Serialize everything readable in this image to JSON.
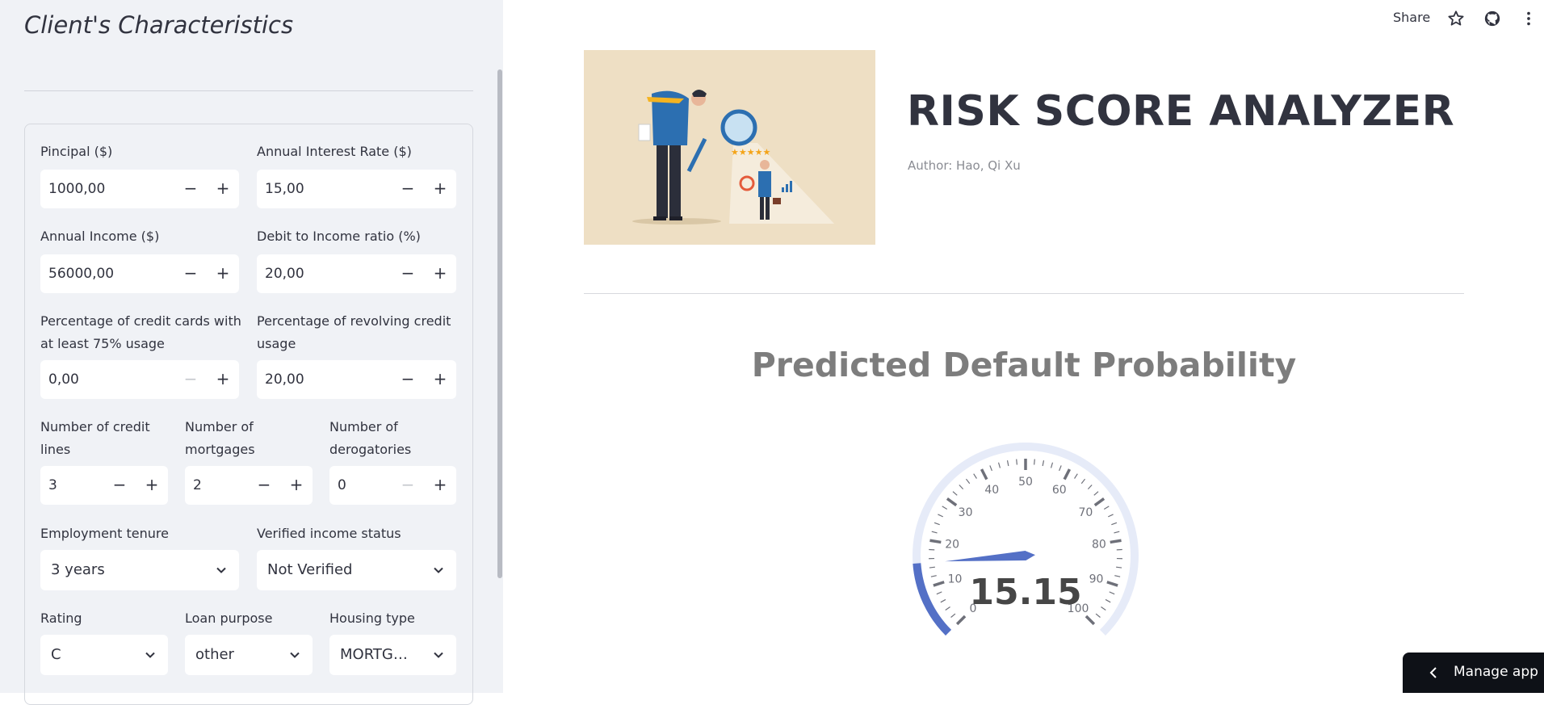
{
  "sidebar": {
    "title": "Client's Characteristics",
    "fields": {
      "principal": {
        "label": "Pincipal ($)",
        "value": "1000,00"
      },
      "interest": {
        "label": "Annual Interest Rate ($)",
        "value": "15,00"
      },
      "income": {
        "label": "Annual Income ($)",
        "value": "56000,00"
      },
      "dti": {
        "label": "Debit to Income ratio (%)",
        "value": "20,00"
      },
      "cc75_line1": "Percentage of credit cards with",
      "cc75_line2": "at least 75% usage",
      "cc75_value": "0,00",
      "revolving_line1": "Percentage of revolving credit",
      "revolving_line2": "usage",
      "revolving_value": "20,00",
      "credit_lines_line1": "Number of credit",
      "credit_lines_line2": "lines",
      "credit_lines_value": "3",
      "mortgages_line1": "Number of",
      "mortgages_line2": "mortgages",
      "mortgages_value": "2",
      "derog_line1": "Number of",
      "derog_line2": "derogatories",
      "derog_value": "0",
      "tenure": {
        "label": "Employment tenure",
        "value": "3 years"
      },
      "verified": {
        "label": "Verified income status",
        "value": "Not Verified"
      },
      "rating": {
        "label": "Rating",
        "value": "C"
      },
      "purpose": {
        "label": "Loan purpose",
        "value": "other"
      },
      "housing": {
        "label": "Housing type",
        "value": "MORTG…"
      }
    },
    "minus_symbol": "−",
    "plus_symbol": "+"
  },
  "topbar": {
    "share": "Share",
    "icons": [
      "star-icon",
      "github-icon",
      "more-vertical-icon"
    ]
  },
  "header": {
    "title": "RISK SCORE ANALYZER",
    "author": "Author: Hao, Qi Xu",
    "hero_rating_stars": 5
  },
  "prediction": {
    "title": "Predicted Default Probability",
    "value": 15.15,
    "value_label": "15.15",
    "gauge_min": 0,
    "gauge_max": 100,
    "tick_labels": [
      "0",
      "10",
      "20",
      "30",
      "40",
      "50",
      "60",
      "70",
      "80",
      "90",
      "100"
    ],
    "bar_color": "#5470c6",
    "track_color": "#e6ebf8"
  },
  "manage_app": "Manage app"
}
